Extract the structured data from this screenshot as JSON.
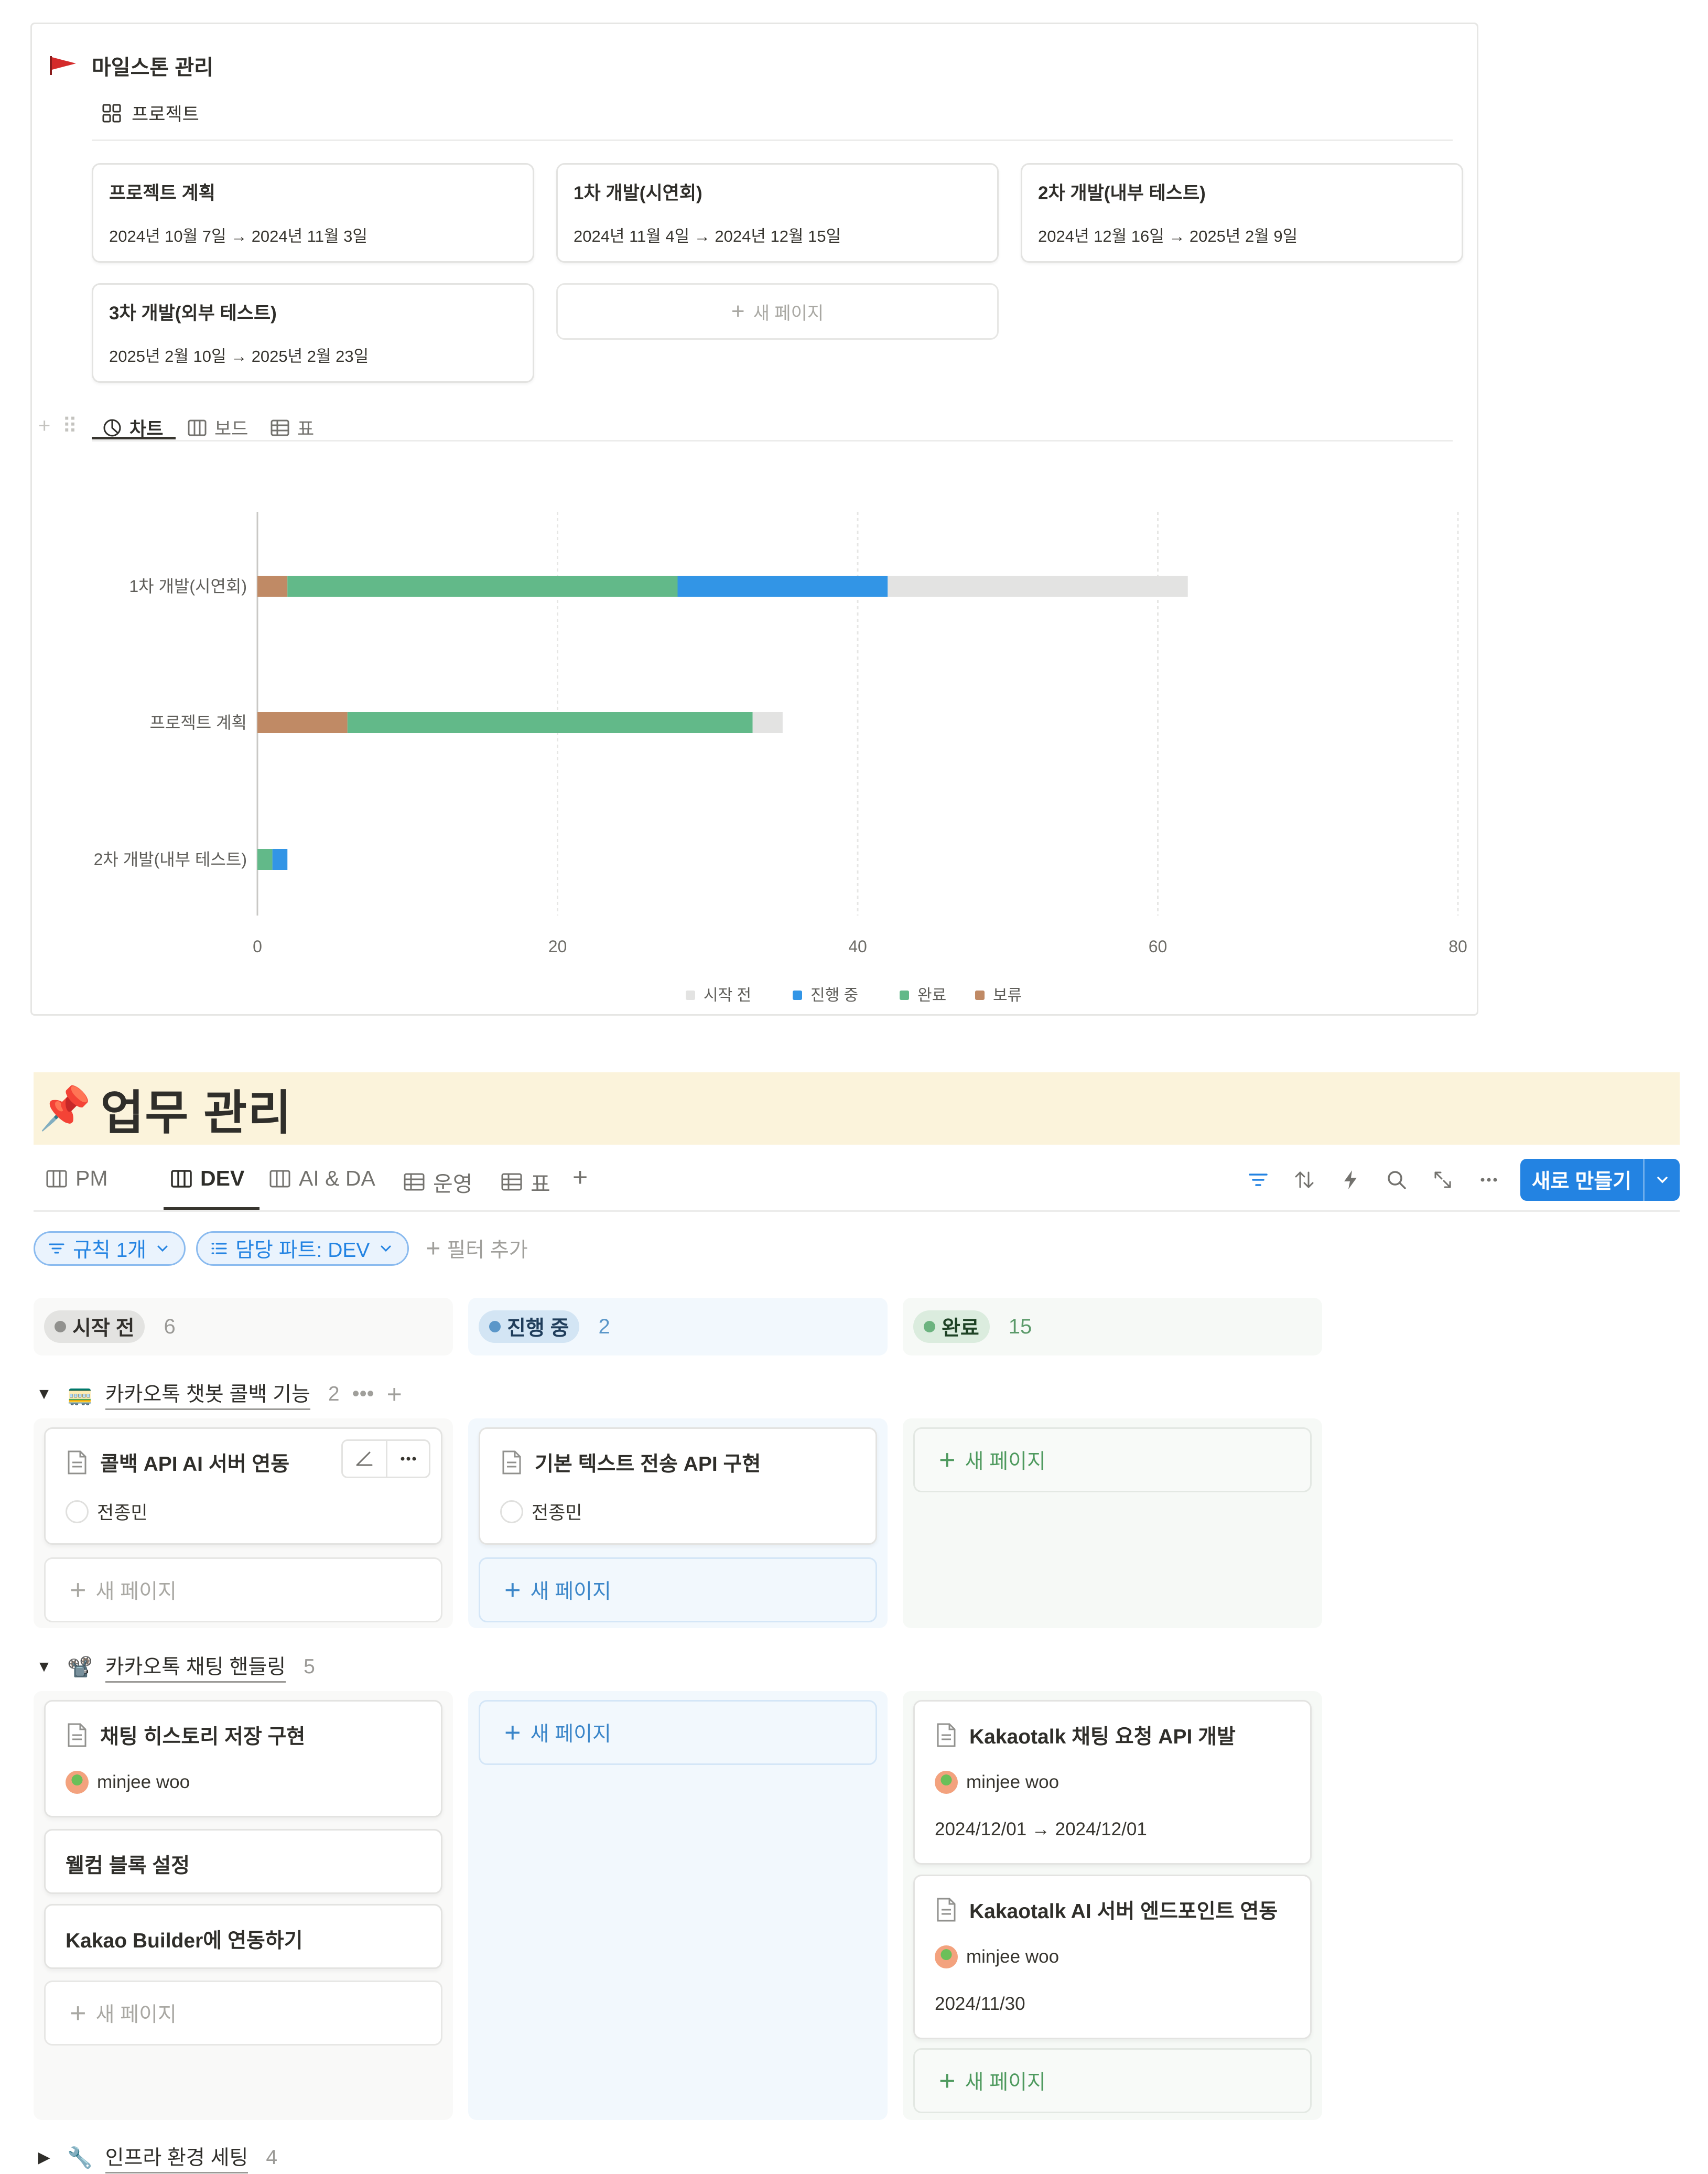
{
  "milestone": {
    "title": "마일스톤 관리",
    "view_label": "프로젝트",
    "cards": [
      {
        "title": "프로젝트 계획",
        "dates": "2024년 10월 7일 → 2024년 11월 3일"
      },
      {
        "title": "1차 개발(시연회)",
        "dates": "2024년 11월 4일 → 2024년 12월 15일"
      },
      {
        "title": "2차 개발(내부 테스트)",
        "dates": "2024년 12월 16일 → 2025년 2월 9일"
      },
      {
        "title": "3차 개발(외부 테스트)",
        "dates": "2025년 2월 10일 → 2025년 2월 23일"
      }
    ],
    "new_page": "새 페이지",
    "tabs": [
      {
        "label": "차트",
        "icon": "chart-icon"
      },
      {
        "label": "보드",
        "icon": "board-icon"
      },
      {
        "label": "표",
        "icon": "table-icon"
      }
    ]
  },
  "chart_data": {
    "type": "bar",
    "orientation": "horizontal",
    "stacked": true,
    "categories": [
      "1차 개발(시연회)",
      "프로젝트 계획",
      "2차 개발(내부 테스트)"
    ],
    "series": [
      {
        "name": "보류",
        "color": "#c08a65",
        "values": [
          2,
          6,
          0
        ]
      },
      {
        "name": "완료",
        "color": "#62b989",
        "values": [
          26,
          27,
          1
        ]
      },
      {
        "name": "진행 중",
        "color": "#3295e6",
        "values": [
          14,
          0,
          1
        ]
      },
      {
        "name": "시작 전",
        "color": "#e3e3e2",
        "values": [
          20,
          2,
          0
        ]
      }
    ],
    "legend_order": [
      "시작 전",
      "진행 중",
      "완료",
      "보류"
    ],
    "xlim": [
      0,
      80
    ],
    "xticks": [
      "0",
      "20",
      "40",
      "60",
      "80"
    ],
    "grid": true,
    "legend_position": "bottom"
  },
  "tasks": {
    "title": "업무 관리",
    "icon": "pushpin-icon",
    "tabs": [
      {
        "label": "PM",
        "icon": "board-icon"
      },
      {
        "label": "DEV",
        "icon": "board-icon"
      },
      {
        "label": "AI & DA",
        "icon": "board-icon"
      },
      {
        "label": "운영",
        "icon": "table-icon"
      },
      {
        "label": "표",
        "icon": "table-icon"
      }
    ],
    "new_button": "새로 만들기",
    "filters": {
      "rule": "규칙 1개",
      "part": "담당 파트: DEV",
      "add": "필터 추가"
    },
    "columns": [
      {
        "label": "시작 전",
        "count": "6",
        "color": "#91918e"
      },
      {
        "label": "진행 중",
        "count": "2",
        "color": "#5b97c9"
      },
      {
        "label": "완료",
        "count": "15",
        "color": "#6cb37f"
      }
    ],
    "groups": [
      {
        "icon": "🚃",
        "name": "카카오톡 챗봇 콜백 기능",
        "count": "2"
      },
      {
        "icon": "📽️",
        "name": "카카오톡 채팅 핸들링",
        "count": "5"
      },
      {
        "icon": "🔧",
        "name": "인프라 환경 세팅",
        "count": "4"
      }
    ],
    "cards": {
      "g1_todo": {
        "title": "콜백 API AI 서버 연동",
        "person": "전종민"
      },
      "g1_doing": {
        "title": "기본 텍스트 전송 API 구현",
        "person": "전종민"
      },
      "g2_todo1": {
        "title": "채팅 히스토리 저장 구현",
        "person": "minjee woo"
      },
      "g2_todo2": {
        "title": "웰컴 블록 설정"
      },
      "g2_todo3": {
        "title": "Kakao Builder에 연동하기"
      },
      "g2_done1": {
        "title": "Kakaotalk 채팅 요청 API 개발",
        "person": "minjee woo",
        "date": "2024/12/01 → 2024/12/01"
      },
      "g2_done2": {
        "title": "Kakaotalk AI 서버 엔드포인트 연동",
        "person": "minjee woo",
        "date": "2024/11/30"
      }
    },
    "new_page": "새 페이지"
  }
}
